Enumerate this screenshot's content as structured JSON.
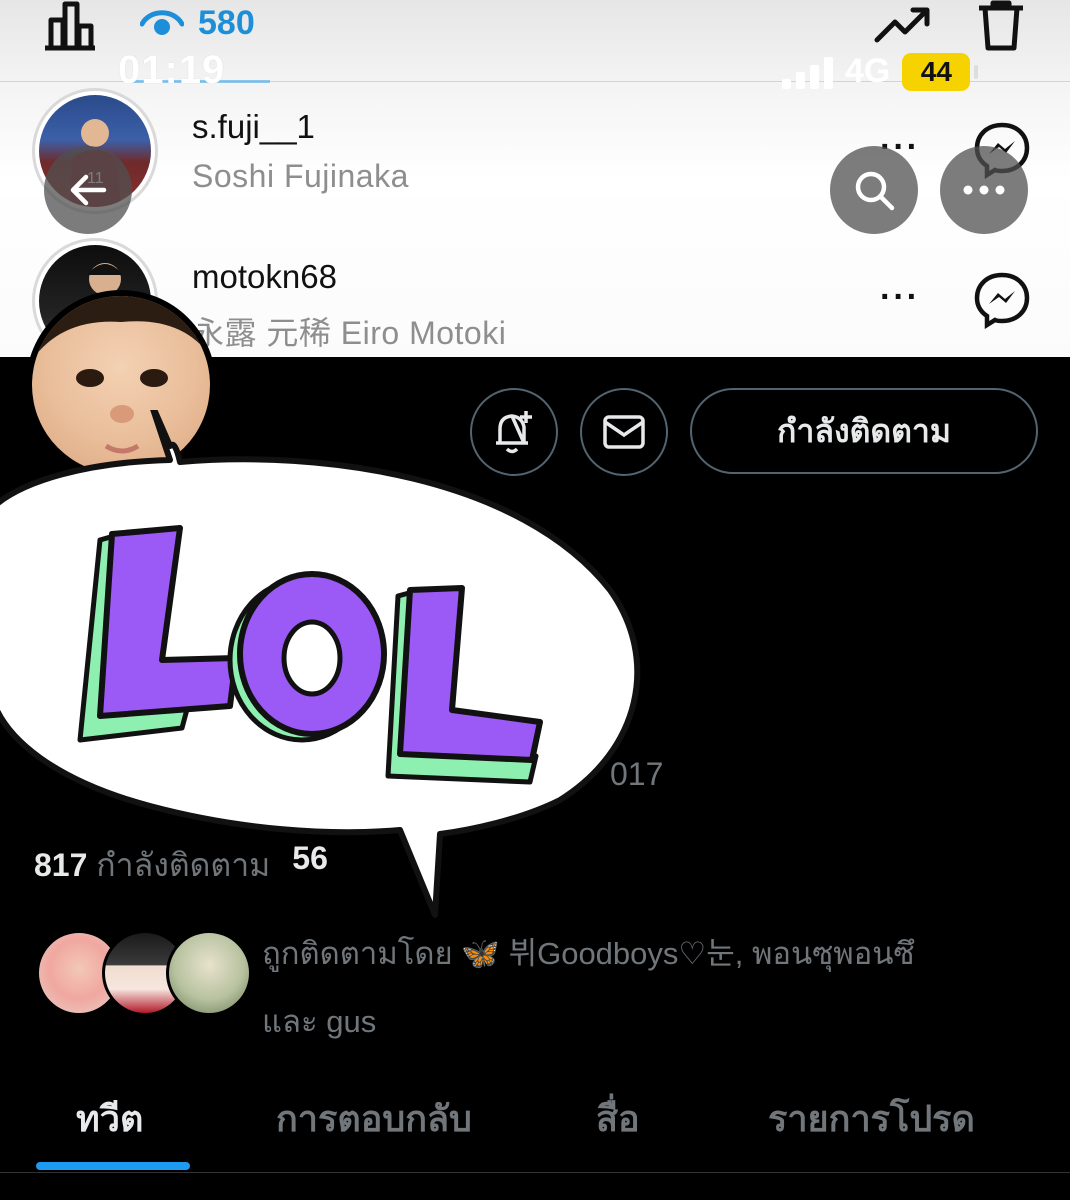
{
  "story_viewer": {
    "view_count": "580",
    "icons": [
      "bar-chart-icon",
      "eye-icon",
      "trending-icon",
      "trash-icon"
    ],
    "viewers": [
      {
        "username": "s.fuji__1",
        "name": "Soshi  Fujinaka",
        "more": "···"
      },
      {
        "username": "motokn68",
        "name": "永露 元稀    Eiro Motoki",
        "more": "···"
      }
    ]
  },
  "status_bar": {
    "time": "01:19",
    "network": "4G",
    "battery": "44"
  },
  "profile": {
    "following_button": "กำลังติดตาม",
    "joined_fragment": "017",
    "stats": {
      "following_count": "817",
      "following_label": "กำลังติดตาม",
      "followers_count": "56"
    },
    "followed_by": {
      "prefix": "ถูกติดตามโดย",
      "names": "🦋 뷔Goodboys♡눈, พอนซุพอนซึ",
      "suffix": "และ gus"
    }
  },
  "tabs": [
    {
      "label": "ทวีต",
      "active": true
    },
    {
      "label": "การตอบกลับ",
      "active": false
    },
    {
      "label": "สื่อ",
      "active": false
    },
    {
      "label": "รายการโปรด",
      "active": false
    }
  ],
  "sticker": {
    "text": "LOL"
  },
  "colors": {
    "accent": "#1d9bf0",
    "eye_blue": "#1d8fd8",
    "battery": "#f6d300",
    "lol_purple": "#9b59f5",
    "lol_green": "#8ef0b0"
  }
}
